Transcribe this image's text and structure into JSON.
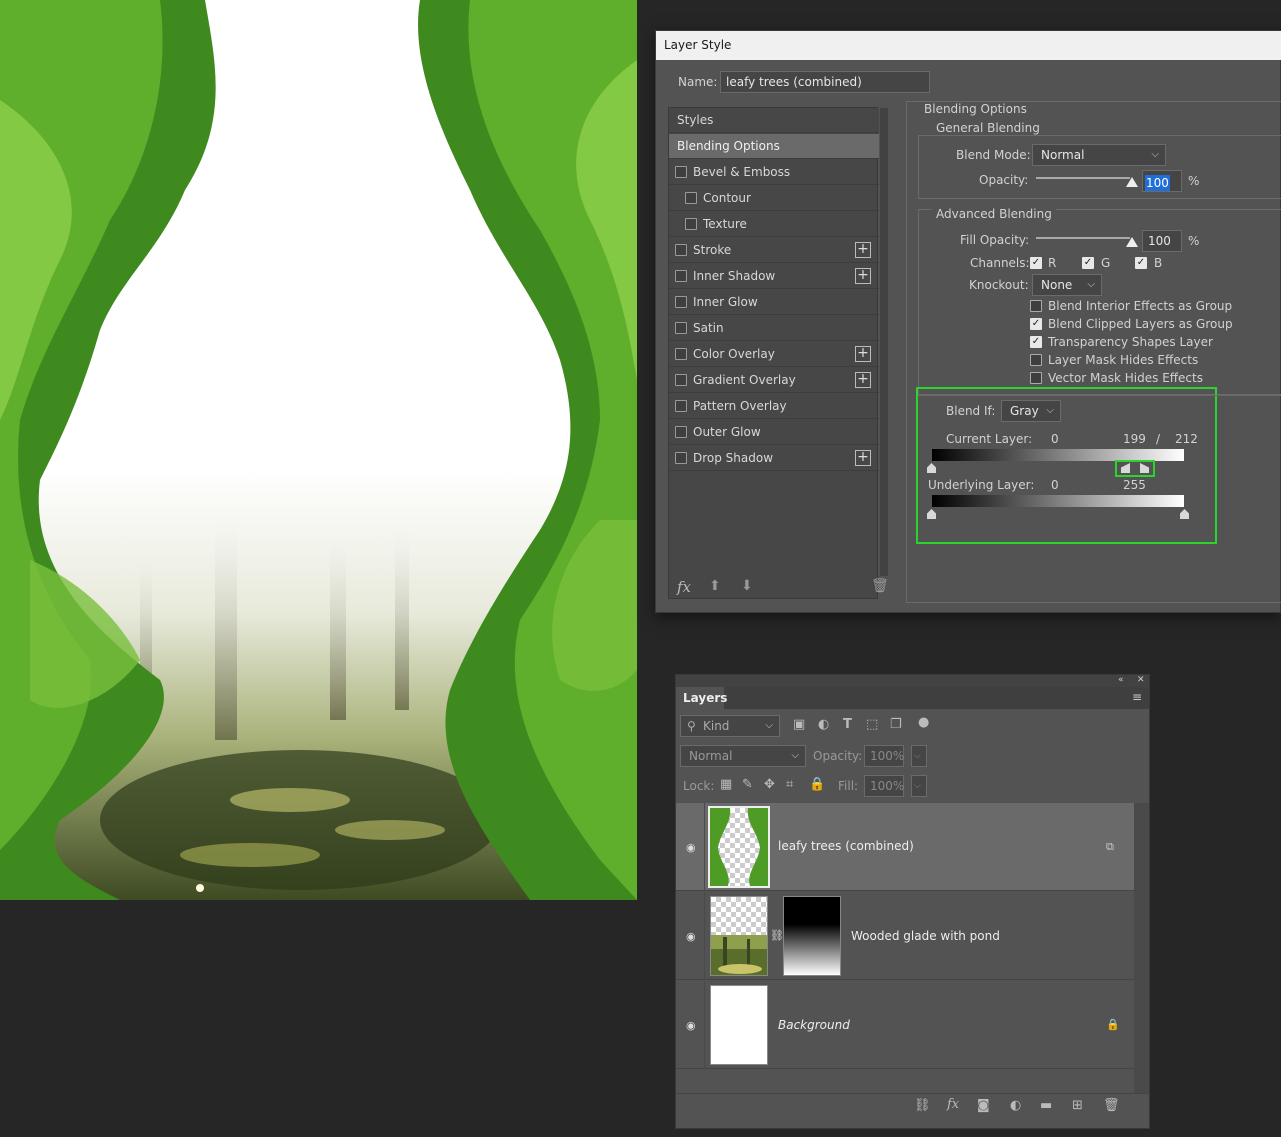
{
  "dialog": {
    "title": "Layer Style",
    "name_label": "Name:",
    "name_value": "leafy trees (combined)"
  },
  "styles_list": {
    "header": "Styles",
    "selected": "Blending Options",
    "items": [
      {
        "label": "Bevel & Emboss",
        "checked": false,
        "plus": false,
        "indent": false
      },
      {
        "label": "Contour",
        "checked": false,
        "plus": false,
        "indent": true
      },
      {
        "label": "Texture",
        "checked": false,
        "plus": false,
        "indent": true
      },
      {
        "label": "Stroke",
        "checked": false,
        "plus": true,
        "indent": false
      },
      {
        "label": "Inner Shadow",
        "checked": false,
        "plus": true,
        "indent": false
      },
      {
        "label": "Inner Glow",
        "checked": false,
        "plus": false,
        "indent": false
      },
      {
        "label": "Satin",
        "checked": false,
        "plus": false,
        "indent": false
      },
      {
        "label": "Color Overlay",
        "checked": false,
        "plus": true,
        "indent": false
      },
      {
        "label": "Gradient Overlay",
        "checked": false,
        "plus": true,
        "indent": false
      },
      {
        "label": "Pattern Overlay",
        "checked": false,
        "plus": false,
        "indent": false
      },
      {
        "label": "Outer Glow",
        "checked": false,
        "plus": false,
        "indent": false
      },
      {
        "label": "Drop Shadow",
        "checked": false,
        "plus": true,
        "indent": false
      }
    ],
    "footer_fx": "fx"
  },
  "blending": {
    "section_title": "Blending Options",
    "general_title": "General Blending",
    "blend_mode_label": "Blend Mode:",
    "blend_mode_value": "Normal",
    "opacity_label": "Opacity:",
    "opacity_value": "100",
    "percent": "%",
    "advanced_title": "Advanced Blending",
    "fill_opacity_label": "Fill Opacity:",
    "fill_opacity_value": "100",
    "channels_label": "Channels:",
    "channels": [
      {
        "label": "R",
        "checked": true
      },
      {
        "label": "G",
        "checked": true
      },
      {
        "label": "B",
        "checked": true
      }
    ],
    "knockout_label": "Knockout:",
    "knockout_value": "None",
    "options": [
      {
        "label": "Blend Interior Effects as Group",
        "checked": false
      },
      {
        "label": "Blend Clipped Layers as Group",
        "checked": true
      },
      {
        "label": "Transparency Shapes Layer",
        "checked": true
      },
      {
        "label": "Layer Mask Hides Effects",
        "checked": false
      },
      {
        "label": "Vector Mask Hides Effects",
        "checked": false
      }
    ],
    "blend_if_label": "Blend If:",
    "blend_if_value": "Gray",
    "current_layer_label": "Current Layer:",
    "current_layer_low": "0",
    "current_layer_high_a": "199",
    "current_layer_slash": "/",
    "current_layer_high_b": "212",
    "underlying_layer_label": "Underlying Layer:",
    "underlying_low": "0",
    "underlying_high": "255"
  },
  "layers_panel": {
    "tab": "Layers",
    "filter_kind": "Kind",
    "blend_mode": "Normal",
    "opacity_label": "Opacity:",
    "opacity_value": "100%",
    "lock_label": "Lock:",
    "fill_label": "Fill:",
    "fill_value": "100%",
    "layers": [
      {
        "name": "leafy trees (combined)",
        "italic": false,
        "selected": true
      },
      {
        "name": "Wooded glade with pond",
        "italic": false,
        "selected": false
      },
      {
        "name": "Background",
        "italic": true,
        "selected": false
      }
    ],
    "footer_fx": "fx"
  },
  "colors": {
    "highlight": "#2ad42a",
    "selected_input": "#1e6fd9"
  }
}
